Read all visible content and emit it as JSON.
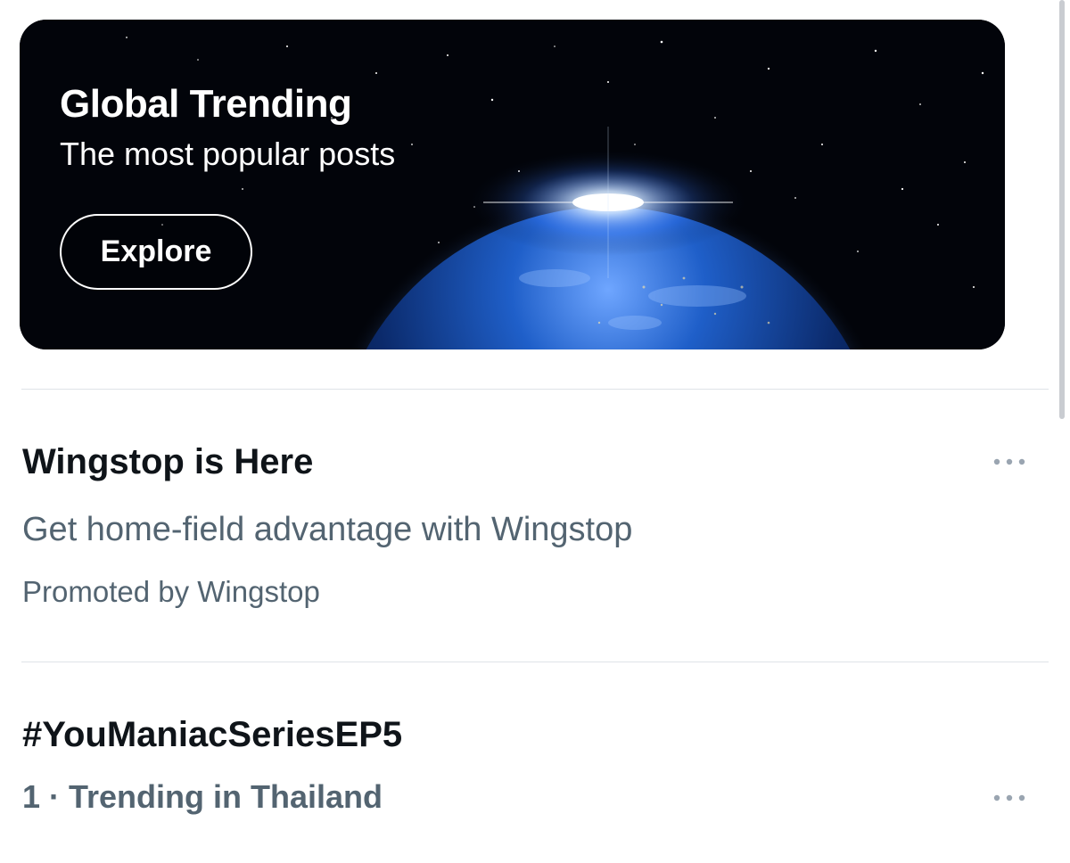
{
  "hero": {
    "title": "Global Trending",
    "subtitle": "The most popular posts",
    "button_label": "Explore"
  },
  "trends": [
    {
      "title": "Wingstop is Here",
      "subtitle": "Get home-field advantage with Wingstop",
      "meta": "Promoted by Wingstop",
      "more_icon": "more-horizontal-icon"
    },
    {
      "title": "#YouManiacSeriesEP5",
      "meta": "1 · Trending in Thailand",
      "more_icon": "more-horizontal-icon"
    }
  ],
  "colors": {
    "primary_text": "#0f1419",
    "secondary_text": "#536471",
    "divider": "#dfe3e8",
    "hero_background": "#02040a"
  }
}
